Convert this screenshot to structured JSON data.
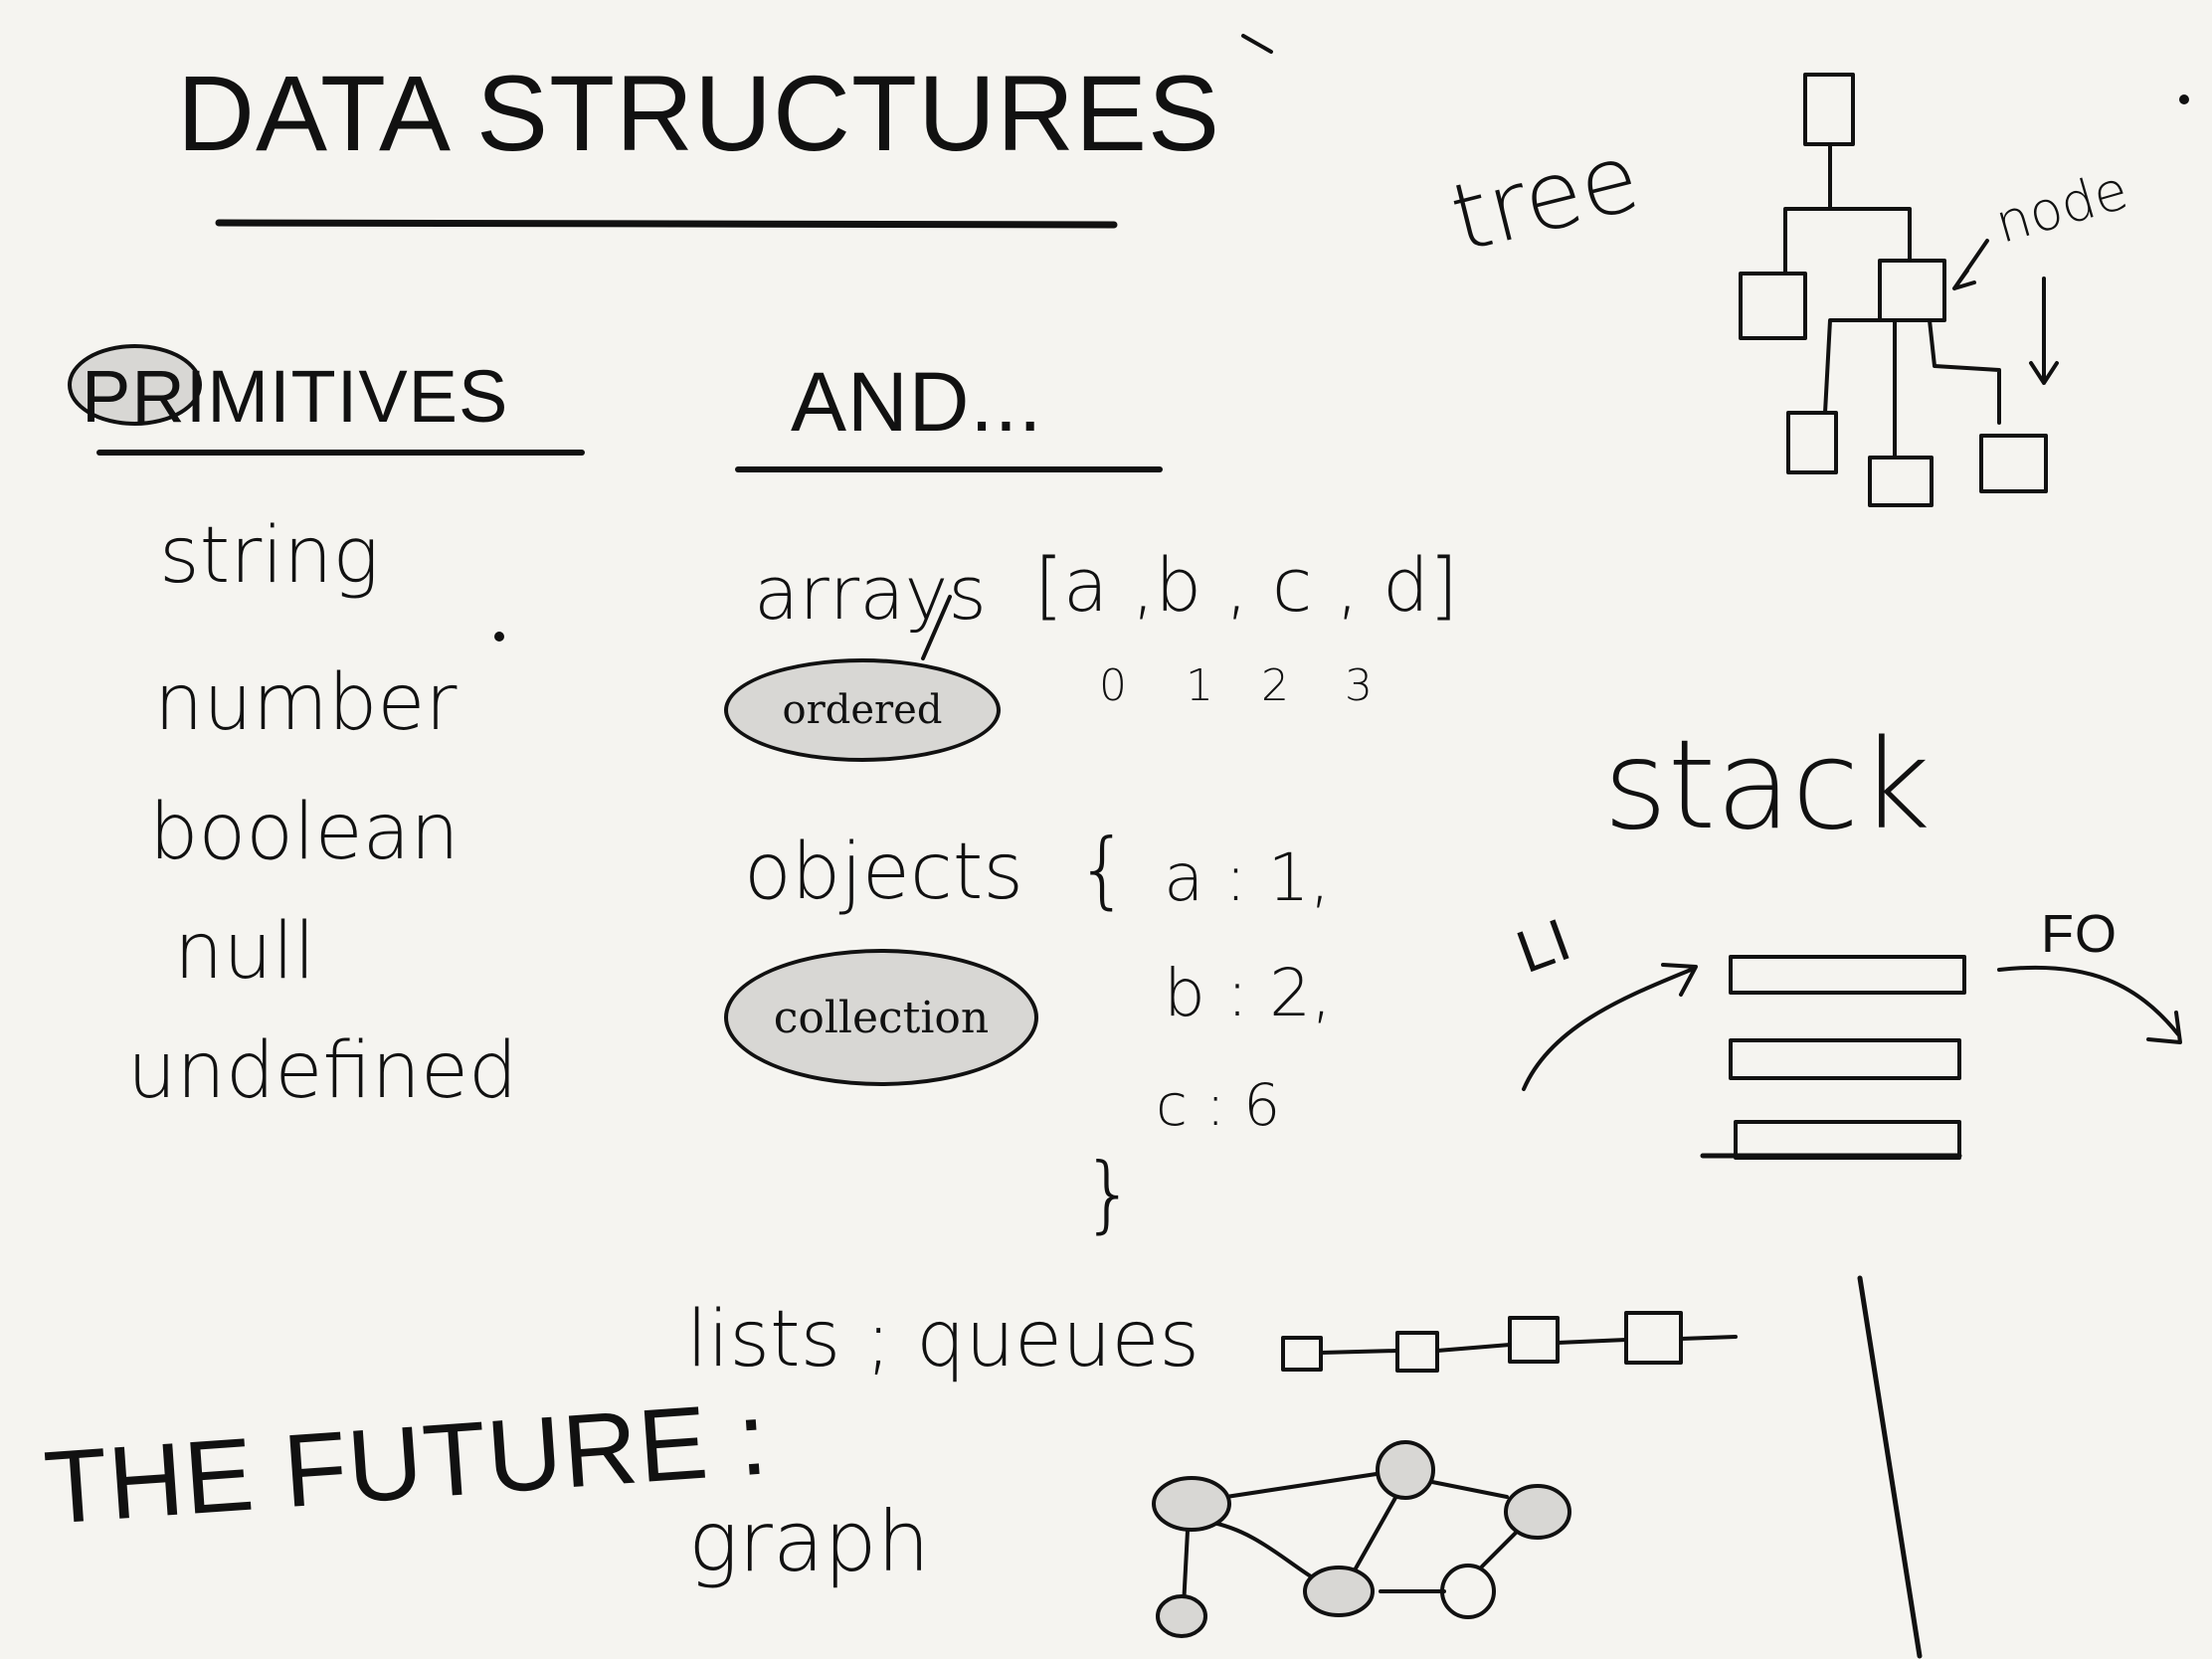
{
  "title": "DATA STRUCTURES",
  "primitives": {
    "heading": "PRIMITIVES",
    "items": [
      "string",
      "number",
      "boolean",
      "null",
      "undefined"
    ]
  },
  "and": {
    "heading": "AND...",
    "arrays": {
      "label": "arrays",
      "literal": "[a ,b , c , d]",
      "indices": [
        "0",
        "1",
        "2",
        "3"
      ],
      "tag": "ordered"
    },
    "objects": {
      "label": "objects",
      "open": "{",
      "close": "}",
      "entries": [
        "a : 1,",
        "b : 2,",
        "c : 6"
      ],
      "tag": "collection"
    }
  },
  "tree": {
    "label": "tree",
    "node_label": "node"
  },
  "stack": {
    "label": "stack",
    "in_label": "LI",
    "out_label": "FO"
  },
  "future": {
    "heading": "THE FUTURE :",
    "lists": "lists ; queues",
    "graph": "graph"
  },
  "colors": {
    "ink": "#111111",
    "paper": "#f5f4f0",
    "highlight": "#d8d7d4"
  }
}
